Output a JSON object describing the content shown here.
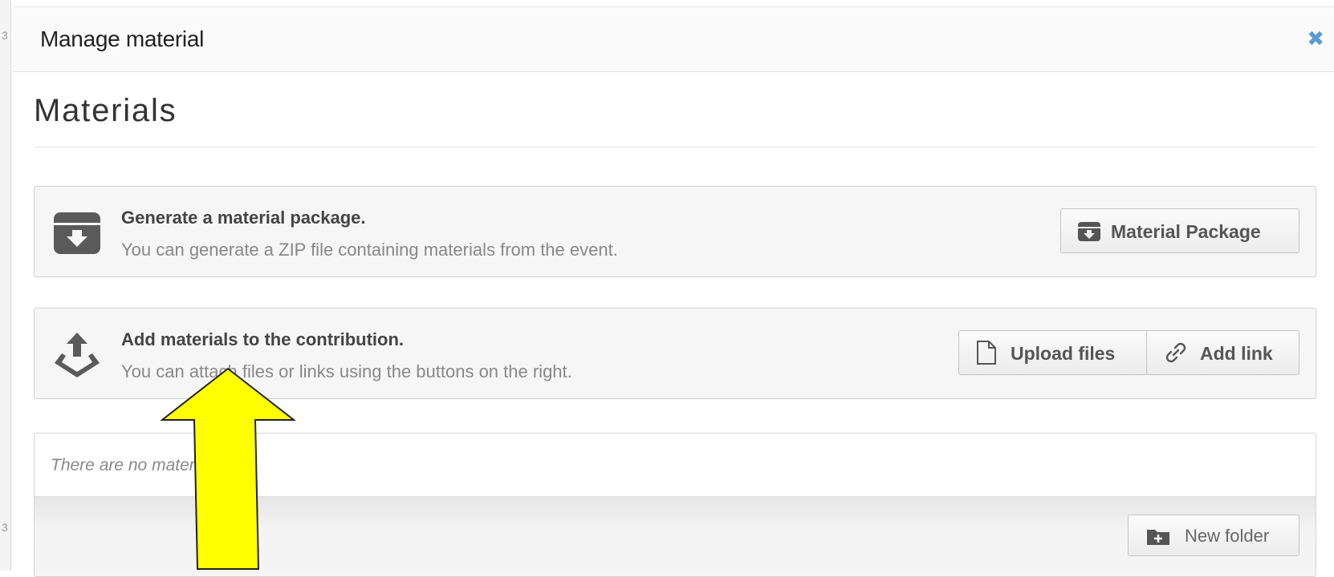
{
  "dialog": {
    "title": "Manage material",
    "close_symbol": "✖"
  },
  "section": {
    "title": "Materials"
  },
  "package_panel": {
    "icon": "archive-download-icon",
    "heading": "Generate a material package.",
    "description": "You can generate a ZIP file containing materials from the event.",
    "button_label": "Material Package"
  },
  "add_panel": {
    "icon": "upload-tray-icon",
    "heading": "Add materials to the contribution.",
    "description": "You can attach files or links using the buttons on the right.",
    "upload_label": "Upload files",
    "link_label": "Add link"
  },
  "materials_list": {
    "empty_text": "There are no materials yet.",
    "new_folder_label": "New folder"
  },
  "colors": {
    "close_accent": "#5b9bd1",
    "annotation_arrow": "#ffff00"
  }
}
